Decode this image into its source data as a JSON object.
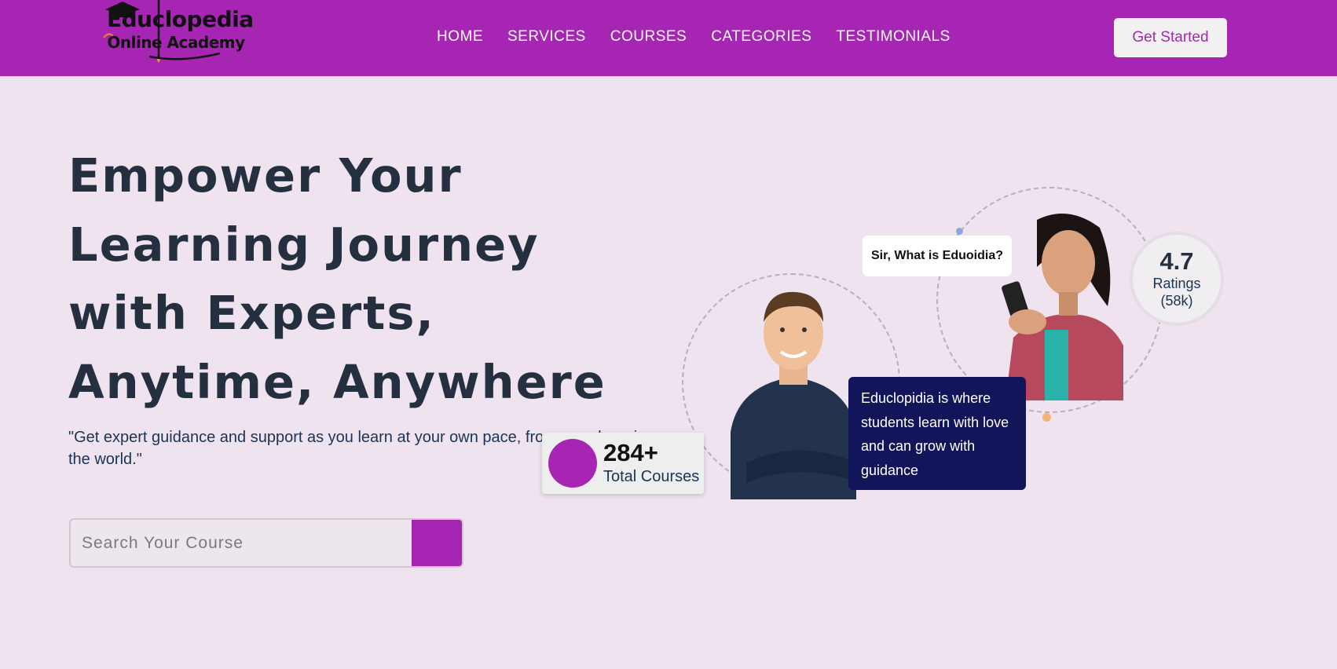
{
  "brand": {
    "logo_line1": "Educlopedia",
    "logo_line2": "Online Academy"
  },
  "nav": {
    "items": [
      "HOME",
      "SERVICES",
      "COURSES",
      "CATEGORIES",
      "TESTIMONIALS"
    ]
  },
  "header": {
    "cta_label": "Get Started"
  },
  "hero": {
    "headline_lines": [
      "Empower Your",
      "Learning Journey",
      "with Experts,",
      "Anytime, Anywhere"
    ],
    "subtext": "\"Get expert guidance and support as you learn at your own pace, from anywhere in the world.\"",
    "search_placeholder": "Search Your Course"
  },
  "illustration": {
    "bubble_text": "Sir, What is Eduoidia?",
    "info_text": "Educlopidia is where students learn with love and can grow with guidance",
    "rating_value": "4.7",
    "rating_label": "Ratings",
    "rating_count": "(58k)",
    "courses_count": "284+",
    "courses_label": "Total Courses"
  },
  "colors": {
    "brand": "#a626b3",
    "background": "#efe3ef",
    "heading": "#243040",
    "info_card": "#13155a"
  }
}
